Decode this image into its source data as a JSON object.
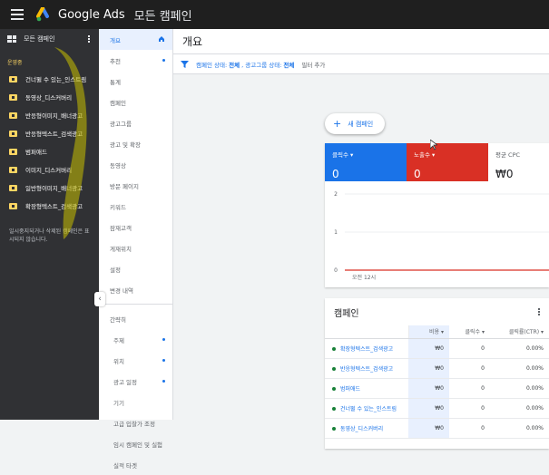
{
  "topbar": {
    "app_name": "Google Ads",
    "breadcrumb": "모든 캠페인"
  },
  "sidebar": {
    "header": "모든 캠페인",
    "section": "운영중",
    "campaigns": [
      "건너뛸 수 있는_인스트림",
      "동영상_디스커버리",
      "반응형이미지_배너광고",
      "반응형텍스트_검색광고",
      "범퍼애드",
      "이미지_디스커버리",
      "일반형이미지_배너광고",
      "확장형텍스트_검색광고"
    ],
    "note": "일시중지되거나 삭제된 캠페인은 표시되지 않습니다."
  },
  "nav": {
    "items": [
      "개요",
      "추천",
      "통계",
      "캠페인",
      "광고그룹",
      "광고 및 확장",
      "동영상",
      "방문 페이지",
      "키워드",
      "잠재고객",
      "게재위치",
      "설정",
      "변경 내역"
    ],
    "collapsed_section": "간략히",
    "sub_items": [
      "주제",
      "위치",
      "광고 일정",
      "기기",
      "고급 입찰가 조정",
      "임시 캠페인 및 실험",
      "실적 타겟"
    ]
  },
  "main": {
    "title": "개요",
    "filter": {
      "prefix": "캠페인 상태:",
      "value1": "전체",
      "mid": ", 광고그룹 상태:",
      "value2": "전체",
      "add": "필터 추가"
    },
    "new_campaign": "새 캠페인"
  },
  "metrics": [
    {
      "label": "클릭수",
      "value": "0"
    },
    {
      "label": "노출수",
      "value": "0"
    },
    {
      "label": "평균 CPC",
      "value": "₩0"
    }
  ],
  "chart_data": {
    "type": "line",
    "y_ticks": [
      "2",
      "1",
      "0"
    ],
    "x_label": "오전 12시",
    "ylim": [
      0,
      2
    ],
    "series": [
      {
        "values": [
          0,
          0
        ]
      }
    ]
  },
  "campaign_table": {
    "title": "캠페인",
    "columns": [
      "비용",
      "클릭수",
      "클릭률(CTR)"
    ],
    "rows": [
      {
        "name": "확장형텍스트_검색광고",
        "cost": "₩0",
        "clicks": "0",
        "ctr": "0.00%"
      },
      {
        "name": "반응형텍스트_검색광고",
        "cost": "₩0",
        "clicks": "0",
        "ctr": "0.00%"
      },
      {
        "name": "범퍼애드",
        "cost": "₩0",
        "clicks": "0",
        "ctr": "0.00%"
      },
      {
        "name": "건너뛸 수 있는_인스트림",
        "cost": "₩0",
        "clicks": "0",
        "ctr": "0.00%"
      },
      {
        "name": "동영상_디스커버리",
        "cost": "₩0",
        "clicks": "0",
        "ctr": "0.00%"
      }
    ]
  },
  "colors": {
    "blue": "#1a73e8",
    "red": "#d93025",
    "highlight": "#fdd663",
    "status_green": "#188038"
  }
}
